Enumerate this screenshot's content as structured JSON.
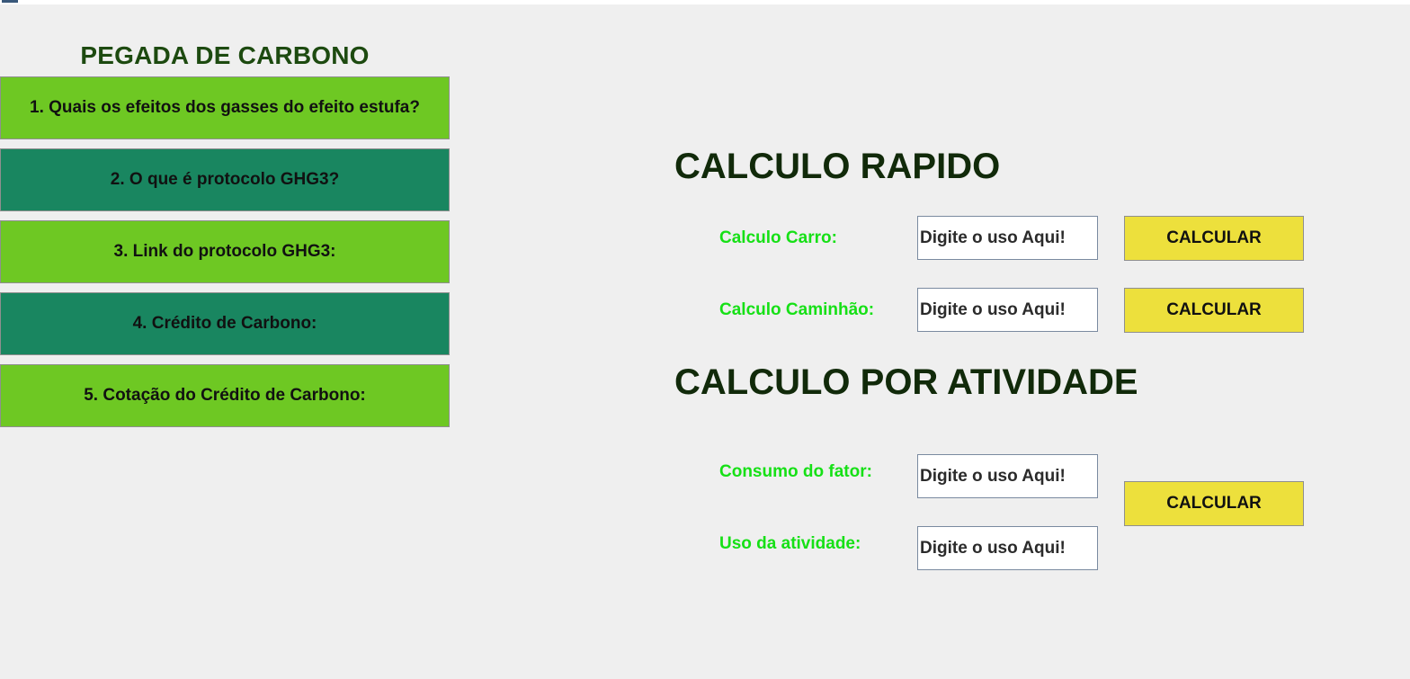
{
  "left_panel": {
    "title": "PEGADA DE CARBONO",
    "items": [
      {
        "label": "1. Quais os efeitos dos gasses do efeito estufa?",
        "color": "#6ec823"
      },
      {
        "label": "2. O que é protocolo GHG3?",
        "color": "#198660"
      },
      {
        "label": "3. Link do protocolo GHG3:",
        "color": "#6ec823"
      },
      {
        "label": "4. Crédito de Carbono:",
        "color": "#198660"
      },
      {
        "label": "5. Cotação do Crédito de Carbono:",
        "color": "#6ec823"
      }
    ]
  },
  "quick_calc": {
    "title": "CALCULO RAPIDO",
    "car": {
      "label": "Calculo Carro:",
      "input_value": "Digite o uso Aqui!",
      "button_label": "CALCULAR"
    },
    "truck": {
      "label": "Calculo Caminhão:",
      "input_value": "Digite o uso Aqui!",
      "button_label": "CALCULAR"
    }
  },
  "activity_calc": {
    "title": "CALCULO POR ATIVIDADE",
    "factor": {
      "label": "Consumo do fator:",
      "input_value": "Digite o uso Aqui!"
    },
    "usage": {
      "label": "Uso da atividade:",
      "input_value": "Digite o uso Aqui!"
    },
    "button_label": "CALCULAR"
  },
  "colors": {
    "background": "#efefef",
    "menu_light": "#6ec823",
    "menu_dark": "#198660",
    "button_yellow": "#ede03c",
    "label_green": "#16e016",
    "heading_dark": "#112a0a"
  }
}
